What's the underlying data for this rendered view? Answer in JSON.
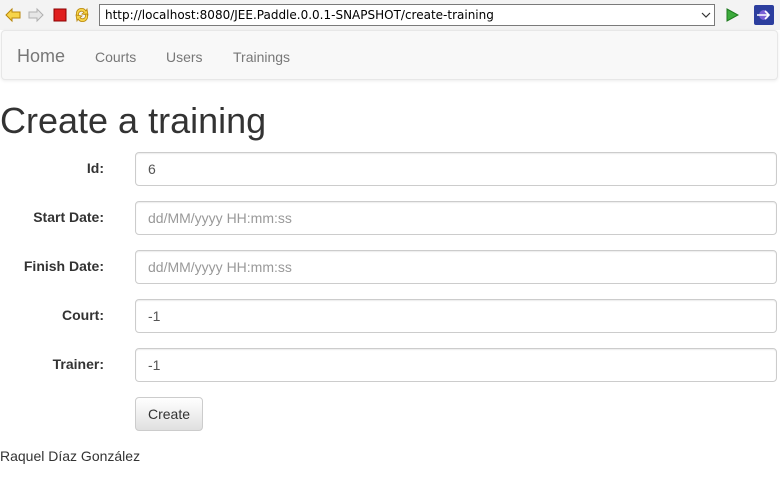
{
  "browser": {
    "url": "http://localhost:8080/JEE.Paddle.0.0.1-SNAPSHOT/create-training",
    "icons": [
      "back-icon",
      "forward-icon",
      "stop-icon",
      "refresh-icon",
      "url-dropdown-icon",
      "go-icon",
      "app-icon"
    ]
  },
  "nav": {
    "brand": "Home",
    "links": [
      "Courts",
      "Users",
      "Trainings"
    ]
  },
  "page": {
    "title": "Create a training"
  },
  "form": {
    "fields": [
      {
        "label": "Id:",
        "value": "6",
        "placeholder": ""
      },
      {
        "label": "Start Date:",
        "value": "",
        "placeholder": "dd/MM/yyyy HH:mm:ss"
      },
      {
        "label": "Finish Date:",
        "value": "",
        "placeholder": "dd/MM/yyyy HH:mm:ss"
      },
      {
        "label": "Court:",
        "value": "-1",
        "placeholder": ""
      },
      {
        "label": "Trainer:",
        "value": "-1",
        "placeholder": ""
      }
    ],
    "submit_label": "Create"
  },
  "footer": {
    "author": "Raquel Díaz González"
  }
}
